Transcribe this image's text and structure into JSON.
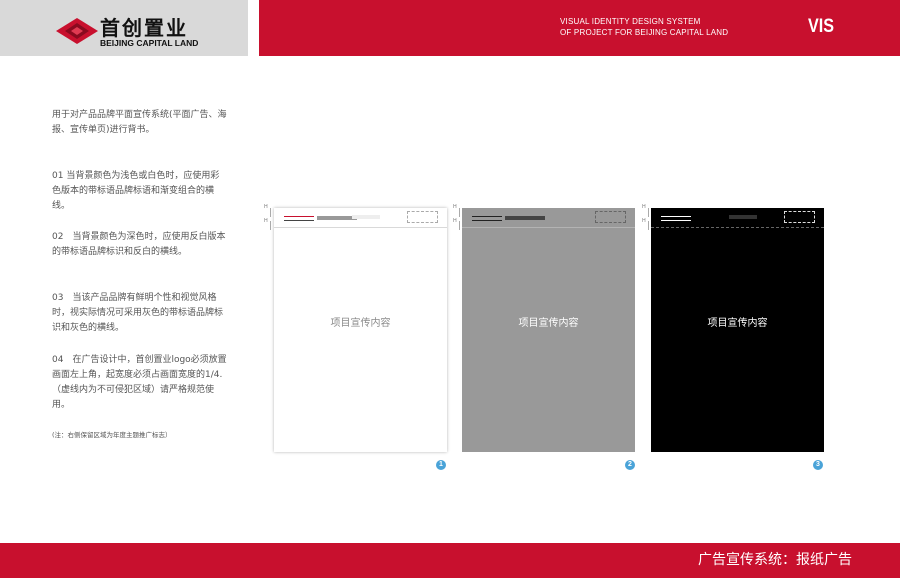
{
  "header": {
    "logo_cn": "首创置业",
    "logo_en": "BEIJING CAPITAL LAND",
    "subtitle_line1": "VISUAL IDENTITY DESIGN SYSTEM",
    "subtitle_line2": "OF PROJECT FOR BEIJING CAPITAL LAND",
    "vis_label": "VIS",
    "colors": {
      "brand_red": "#c8102e",
      "logo_panel_gray": "#d9d9d9"
    }
  },
  "body": {
    "intro": "用于对产品品牌平面宣传系统(平面广告、海报、宣传单页)进行背书。",
    "paragraphs": [
      "01 当背景颜色为浅色或白色时，应使用彩色版本的带标语品牌标语和渐变组合的横线。",
      "02　当背景颜色为深色时，应使用反白版本的带标语品牌标识和反白的横线。",
      "03　当该产品品牌有鲜明个性和视觉风格时，视实际情况可采用灰色的带标语品牌标识和灰色的横线。",
      "04　在广告设计中，首创置业logo必须放置画面左上角，起宽度必须占画面宽度的1/4.（虚线内为不可侵犯区域）请严格规范使用。"
    ],
    "note": "(注：右侧保留区域为年度主题推广标志）"
  },
  "panels": [
    {
      "content": "项目宣传内容",
      "number": "1",
      "background": "#ffffff"
    },
    {
      "content": "项目宣传内容",
      "number": "2",
      "background": "#999999"
    },
    {
      "content": "项目宣传内容",
      "number": "3",
      "background": "#000000"
    }
  ],
  "footer": {
    "title": "广告宣传系统：报纸广告"
  }
}
